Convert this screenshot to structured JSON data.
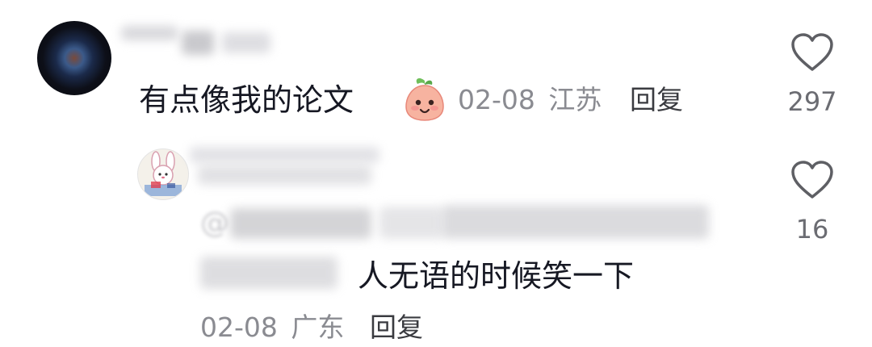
{
  "comment": {
    "text": "有点像我的论文",
    "date": "02-08",
    "location": "江苏",
    "reply_label": "回复",
    "like_count": "297"
  },
  "reply": {
    "mention_prefix": "@",
    "text": "人无语的时候笑一下",
    "date": "02-08",
    "location": "广东",
    "reply_label": "回复",
    "like_count": "16"
  },
  "icons": {
    "like": "heart-outline-icon",
    "emoji": "smiling-peach-emoji"
  },
  "colors": {
    "text": "#161823",
    "meta": "#8a8b91",
    "reply_action": "#3a3b40",
    "icon": "#5e5f64"
  }
}
